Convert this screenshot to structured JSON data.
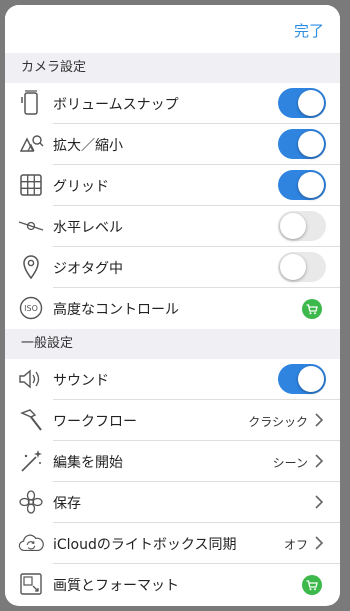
{
  "header": {
    "done_label": "完了"
  },
  "camera_section": {
    "title": "カメラ設定",
    "rows": [
      {
        "label": "ボリュームスナップ",
        "icon": "phone-volume-icon",
        "toggle": true
      },
      {
        "label": "拡大／縮小",
        "icon": "zoom-icon",
        "toggle": true
      },
      {
        "label": "グリッド",
        "icon": "grid-icon",
        "toggle": true
      },
      {
        "label": "水平レベル",
        "icon": "level-icon",
        "toggle": false
      },
      {
        "label": "ジオタグ中",
        "icon": "location-pin-icon",
        "toggle": false
      },
      {
        "label": "高度なコントロール",
        "icon": "iso-icon",
        "badge": "cart-icon"
      }
    ]
  },
  "general_section": {
    "title": "一般設定",
    "rows": [
      {
        "label": "サウンド",
        "icon": "speaker-icon",
        "toggle": true
      },
      {
        "label": "ワークフロー",
        "icon": "hammer-icon",
        "value": "クラシック"
      },
      {
        "label": "編集を開始",
        "icon": "magic-wand-icon",
        "value": "シーン"
      },
      {
        "label": "保存",
        "icon": "flower-icon",
        "value": ""
      },
      {
        "label": "iCloudのライトボックス同期",
        "icon": "cloud-sync-icon",
        "value": "オフ"
      },
      {
        "label": "画質とフォーマット",
        "icon": "image-format-icon",
        "badge": "cart-icon"
      }
    ]
  },
  "colors": {
    "accent": "#2f84e0",
    "toggle_off": "#e9e9ea",
    "cart": "#3cb94a",
    "section_bg": "#efeff4"
  }
}
